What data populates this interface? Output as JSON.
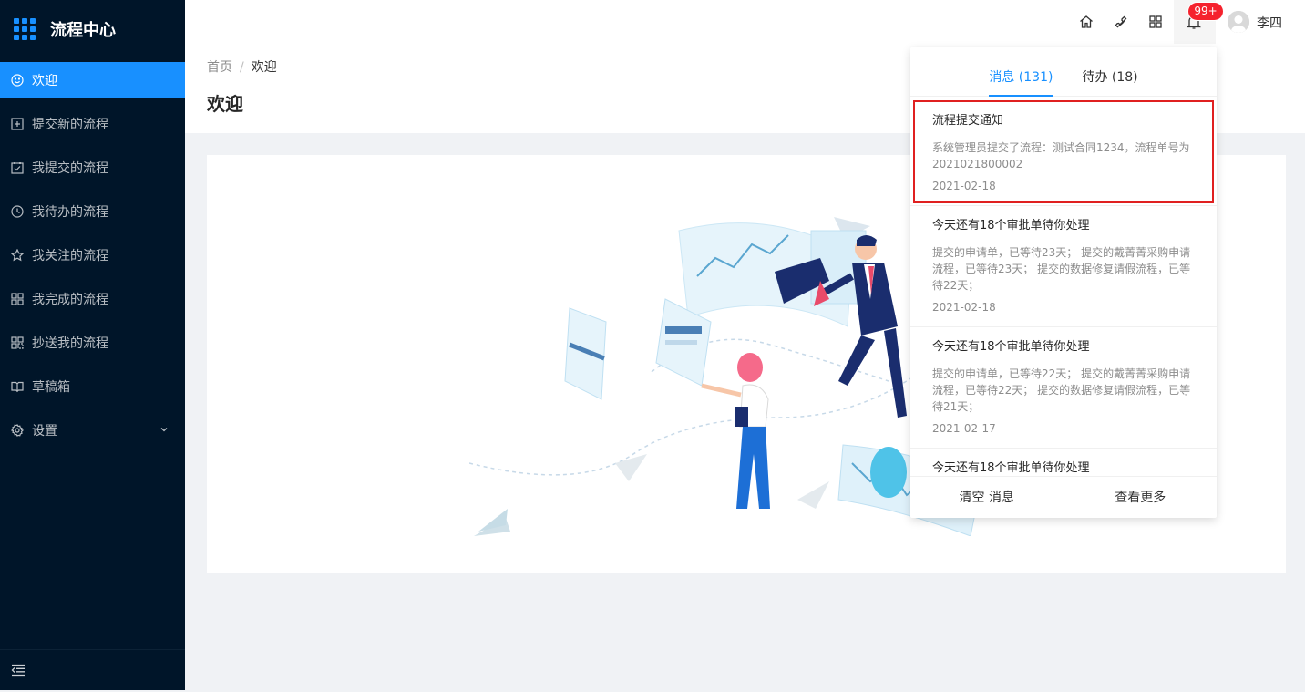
{
  "app": {
    "title": "流程中心"
  },
  "sidebar": {
    "items": [
      {
        "label": "欢迎",
        "icon": "smile-icon",
        "active": true
      },
      {
        "label": "提交新的流程",
        "icon": "plus-square-icon"
      },
      {
        "label": "我提交的流程",
        "icon": "check-square-icon"
      },
      {
        "label": "我待办的流程",
        "icon": "clock-icon"
      },
      {
        "label": "我关注的流程",
        "icon": "star-icon"
      },
      {
        "label": "我完成的流程",
        "icon": "appstore-icon"
      },
      {
        "label": "抄送我的流程",
        "icon": "copy-icon"
      },
      {
        "label": "草稿箱",
        "icon": "book-icon"
      },
      {
        "label": "设置",
        "icon": "gear-icon"
      }
    ]
  },
  "header": {
    "badge": "99+",
    "username": "李四"
  },
  "breadcrumb": {
    "home": "首页",
    "sep": "/",
    "current": "欢迎"
  },
  "page": {
    "title": "欢迎"
  },
  "notifications": {
    "tabs": [
      {
        "label": "消息 (131)",
        "active": true
      },
      {
        "label": "待办 (18)",
        "active": false
      }
    ],
    "items": [
      {
        "title": "流程提交通知",
        "desc": "系统管理员提交了流程：测试合同1234，流程单号为2021021800002",
        "date": "2021-02-18"
      },
      {
        "title": "今天还有18个审批单待你处理",
        "desc": "提交的申请单，已等待23天； 提交的戴菁菁采购申请流程，已等待23天； 提交的数据修复请假流程，已等待22天；",
        "date": "2021-02-18"
      },
      {
        "title": "今天还有18个审批单待你处理",
        "desc": "提交的申请单，已等待22天； 提交的戴菁菁采购申请流程，已等待22天； 提交的数据修复请假流程，已等待21天；",
        "date": "2021-02-17"
      },
      {
        "title": "今天还有18个审批单待你处理",
        "desc": "",
        "date": ""
      }
    ],
    "footer": {
      "clear": "清空 消息",
      "more": "查看更多"
    }
  },
  "colors": {
    "sidebar_bg": "#001529",
    "accent": "#1890ff",
    "badge": "#f5222d",
    "highlight_border": "#e02020"
  }
}
